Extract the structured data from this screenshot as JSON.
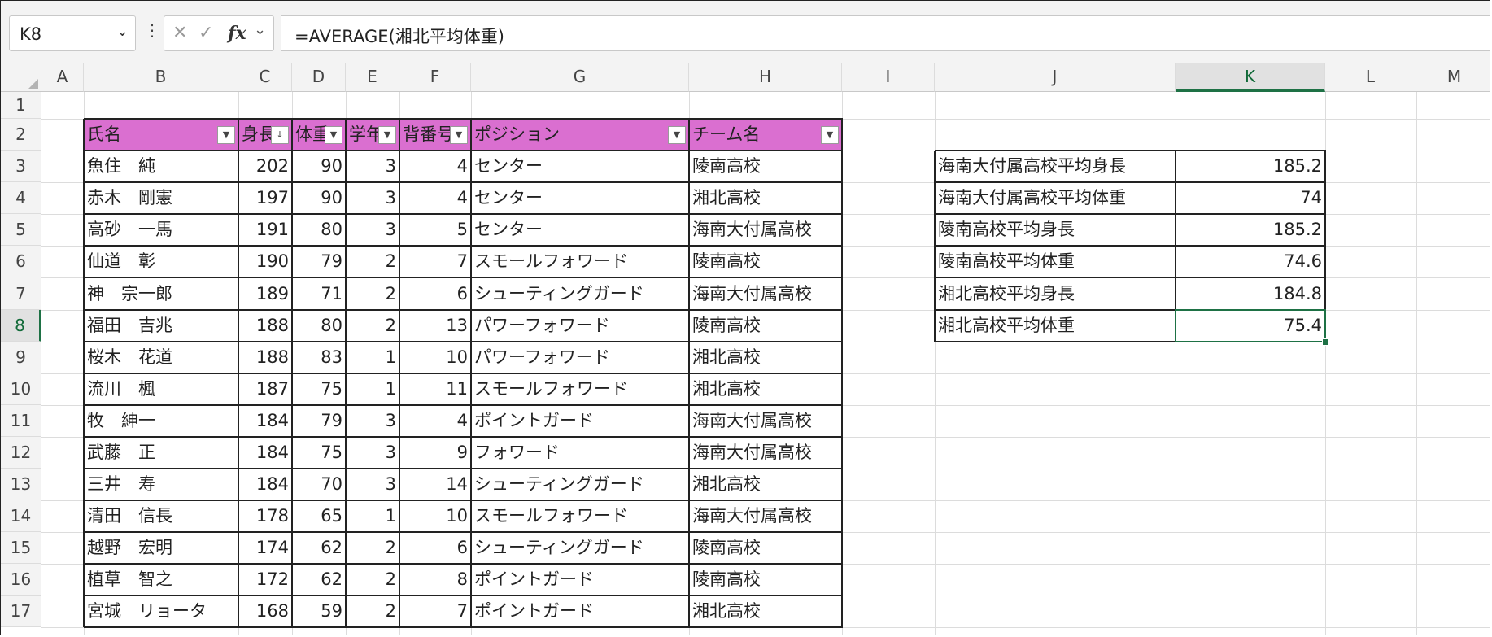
{
  "name_box": "K8",
  "formula": "=AVERAGE(湘北平均体重)",
  "fx_label": "fx",
  "columns": [
    "A",
    "B",
    "C",
    "D",
    "E",
    "F",
    "G",
    "H",
    "I",
    "J",
    "K",
    "L",
    "M"
  ],
  "rows": [
    "1",
    "2",
    "3",
    "4",
    "5",
    "6",
    "7",
    "8",
    "9",
    "10",
    "11",
    "12",
    "13",
    "14",
    "15",
    "16",
    "17"
  ],
  "selected_column": "K",
  "selected_row": "8",
  "table": {
    "headers": [
      "氏名",
      "身長",
      "体重",
      "学年",
      "背番号",
      "ポジション",
      "チーム名"
    ],
    "sort_indicator": "↓",
    "rows": [
      [
        "魚住　純",
        "202",
        "90",
        "3",
        "4",
        "センター",
        "陵南高校"
      ],
      [
        "赤木　剛憲",
        "197",
        "90",
        "3",
        "4",
        "センター",
        "湘北高校"
      ],
      [
        "高砂　一馬",
        "191",
        "80",
        "3",
        "5",
        "センター",
        "海南大付属高校"
      ],
      [
        "仙道　彰",
        "190",
        "79",
        "2",
        "7",
        "スモールフォワード",
        "陵南高校"
      ],
      [
        "神　宗一郎",
        "189",
        "71",
        "2",
        "6",
        "シューティングガード",
        "海南大付属高校"
      ],
      [
        "福田　吉兆",
        "188",
        "80",
        "2",
        "13",
        "パワーフォワード",
        "陵南高校"
      ],
      [
        "桜木　花道",
        "188",
        "83",
        "1",
        "10",
        "パワーフォワード",
        "湘北高校"
      ],
      [
        "流川　楓",
        "187",
        "75",
        "1",
        "11",
        "スモールフォワード",
        "湘北高校"
      ],
      [
        "牧　紳一",
        "184",
        "79",
        "3",
        "4",
        "ポイントガード",
        "海南大付属高校"
      ],
      [
        "武藤　正",
        "184",
        "75",
        "3",
        "9",
        "フォワード",
        "海南大付属高校"
      ],
      [
        "三井　寿",
        "184",
        "70",
        "3",
        "14",
        "シューティングガード",
        "湘北高校"
      ],
      [
        "清田　信長",
        "178",
        "65",
        "1",
        "10",
        "スモールフォワード",
        "海南大付属高校"
      ],
      [
        "越野　宏明",
        "174",
        "62",
        "2",
        "6",
        "シューティングガード",
        "陵南高校"
      ],
      [
        "植草　智之",
        "172",
        "62",
        "2",
        "8",
        "ポイントガード",
        "陵南高校"
      ],
      [
        "宮城　リョータ",
        "168",
        "59",
        "2",
        "7",
        "ポイントガード",
        "湘北高校"
      ]
    ]
  },
  "summary": [
    [
      "海南大付属高校平均身長",
      "185.2"
    ],
    [
      "海南大付属高校平均体重",
      "74"
    ],
    [
      "陵南高校平均身長",
      "185.2"
    ],
    [
      "陵南高校平均体重",
      "74.6"
    ],
    [
      "湘北高校平均身長",
      "184.8"
    ],
    [
      "湘北高校平均体重",
      "75.4"
    ]
  ],
  "colors": {
    "table_header_bg": "#da6fd0",
    "selection": "#1e7145",
    "sheet_chrome": "#f3f3f3"
  }
}
